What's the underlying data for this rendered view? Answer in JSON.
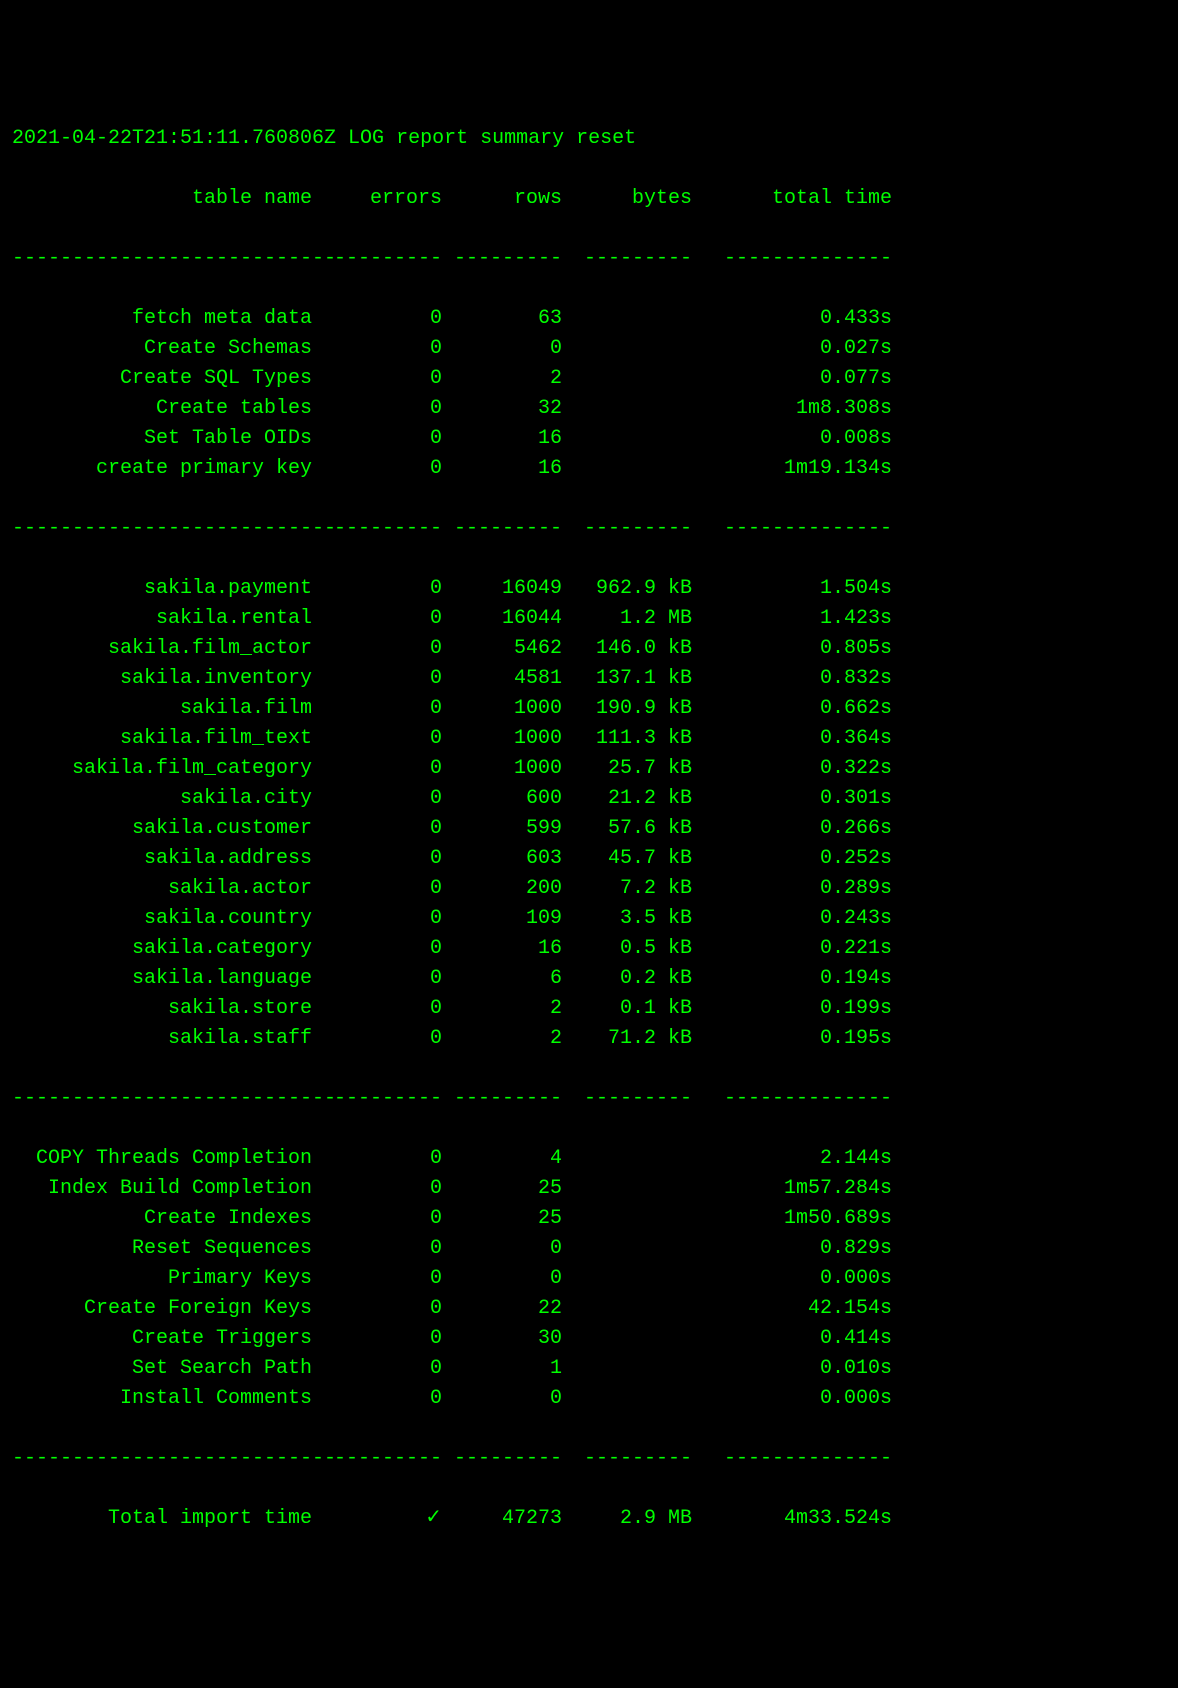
{
  "log_line": "2021-04-22T21:51:11.760806Z LOG report summary reset",
  "headers": {
    "name": "table name",
    "errors": "errors",
    "rows": "rows",
    "bytes": "bytes",
    "time": "total time"
  },
  "section1": [
    {
      "name": "fetch meta data",
      "errors": "0",
      "rows": "63",
      "bytes": "",
      "time": "0.433s"
    },
    {
      "name": "Create Schemas",
      "errors": "0",
      "rows": "0",
      "bytes": "",
      "time": "0.027s"
    },
    {
      "name": "Create SQL Types",
      "errors": "0",
      "rows": "2",
      "bytes": "",
      "time": "0.077s"
    },
    {
      "name": "Create tables",
      "errors": "0",
      "rows": "32",
      "bytes": "",
      "time": "1m8.308s"
    },
    {
      "name": "Set Table OIDs",
      "errors": "0",
      "rows": "16",
      "bytes": "",
      "time": "0.008s"
    },
    {
      "name": "create primary key",
      "errors": "0",
      "rows": "16",
      "bytes": "",
      "time": "1m19.134s"
    }
  ],
  "section2": [
    {
      "name": "sakila.payment",
      "errors": "0",
      "rows": "16049",
      "bytes": "962.9 kB",
      "time": "1.504s"
    },
    {
      "name": "sakila.rental",
      "errors": "0",
      "rows": "16044",
      "bytes": "1.2 MB",
      "time": "1.423s"
    },
    {
      "name": "sakila.film_actor",
      "errors": "0",
      "rows": "5462",
      "bytes": "146.0 kB",
      "time": "0.805s"
    },
    {
      "name": "sakila.inventory",
      "errors": "0",
      "rows": "4581",
      "bytes": "137.1 kB",
      "time": "0.832s"
    },
    {
      "name": "sakila.film",
      "errors": "0",
      "rows": "1000",
      "bytes": "190.9 kB",
      "time": "0.662s"
    },
    {
      "name": "sakila.film_text",
      "errors": "0",
      "rows": "1000",
      "bytes": "111.3 kB",
      "time": "0.364s"
    },
    {
      "name": "sakila.film_category",
      "errors": "0",
      "rows": "1000",
      "bytes": "25.7 kB",
      "time": "0.322s"
    },
    {
      "name": "sakila.city",
      "errors": "0",
      "rows": "600",
      "bytes": "21.2 kB",
      "time": "0.301s"
    },
    {
      "name": "sakila.customer",
      "errors": "0",
      "rows": "599",
      "bytes": "57.6 kB",
      "time": "0.266s"
    },
    {
      "name": "sakila.address",
      "errors": "0",
      "rows": "603",
      "bytes": "45.7 kB",
      "time": "0.252s"
    },
    {
      "name": "sakila.actor",
      "errors": "0",
      "rows": "200",
      "bytes": "7.2 kB",
      "time": "0.289s"
    },
    {
      "name": "sakila.country",
      "errors": "0",
      "rows": "109",
      "bytes": "3.5 kB",
      "time": "0.243s"
    },
    {
      "name": "sakila.category",
      "errors": "0",
      "rows": "16",
      "bytes": "0.5 kB",
      "time": "0.221s"
    },
    {
      "name": "sakila.language",
      "errors": "0",
      "rows": "6",
      "bytes": "0.2 kB",
      "time": "0.194s"
    },
    {
      "name": "sakila.store",
      "errors": "0",
      "rows": "2",
      "bytes": "0.1 kB",
      "time": "0.199s"
    },
    {
      "name": "sakila.staff",
      "errors": "0",
      "rows": "2",
      "bytes": "71.2 kB",
      "time": "0.195s"
    }
  ],
  "section3": [
    {
      "name": "COPY Threads Completion",
      "errors": "0",
      "rows": "4",
      "bytes": "",
      "time": "2.144s"
    },
    {
      "name": "Index Build Completion",
      "errors": "0",
      "rows": "25",
      "bytes": "",
      "time": "1m57.284s"
    },
    {
      "name": "Create Indexes",
      "errors": "0",
      "rows": "25",
      "bytes": "",
      "time": "1m50.689s"
    },
    {
      "name": "Reset Sequences",
      "errors": "0",
      "rows": "0",
      "bytes": "",
      "time": "0.829s"
    },
    {
      "name": "Primary Keys",
      "errors": "0",
      "rows": "0",
      "bytes": "",
      "time": "0.000s"
    },
    {
      "name": "Create Foreign Keys",
      "errors": "0",
      "rows": "22",
      "bytes": "",
      "time": "42.154s"
    },
    {
      "name": "Create Triggers",
      "errors": "0",
      "rows": "30",
      "bytes": "",
      "time": "0.414s"
    },
    {
      "name": "Set Search Path",
      "errors": "0",
      "rows": "1",
      "bytes": "",
      "time": "0.010s"
    },
    {
      "name": "Install Comments",
      "errors": "0",
      "rows": "0",
      "bytes": "",
      "time": "0.000s"
    }
  ],
  "total": {
    "name": "Total import time",
    "errors": "✓",
    "rows": "47273",
    "bytes": "2.9 MB",
    "time": "4m33.524s"
  }
}
